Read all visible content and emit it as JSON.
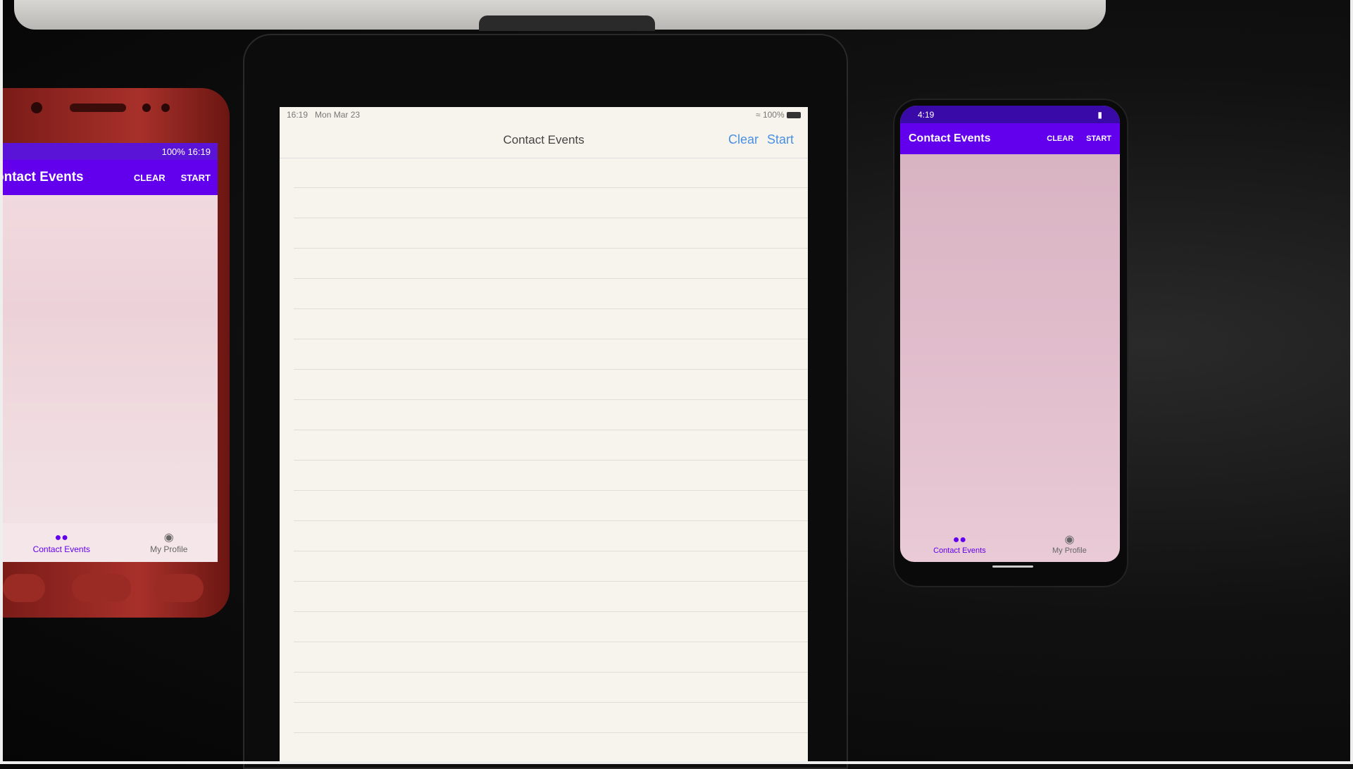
{
  "left_phone": {
    "status": "100% 16:19",
    "app_title": "ontact Events",
    "clear_label": "CLEAR",
    "start_label": "START",
    "nav": [
      {
        "label": "Contact Events",
        "icon": "people-icon"
      },
      {
        "label": "My Profile",
        "icon": "account-icon"
      }
    ]
  },
  "ipad": {
    "time": "16:19",
    "date": "Mon Mar 23",
    "battery": "100%",
    "title": "Contact Events",
    "clear_label": "Clear",
    "start_label": "Start"
  },
  "right_phone": {
    "time": "4:19",
    "app_title": "Contact Events",
    "clear_label": "CLEAR",
    "start_label": "START",
    "nav": [
      {
        "label": "Contact Events",
        "icon": "people-icon"
      },
      {
        "label": "My Profile",
        "icon": "account-icon"
      }
    ]
  },
  "colors": {
    "app_bar": "#6200ee",
    "ios_tint": "#4a90e2"
  }
}
